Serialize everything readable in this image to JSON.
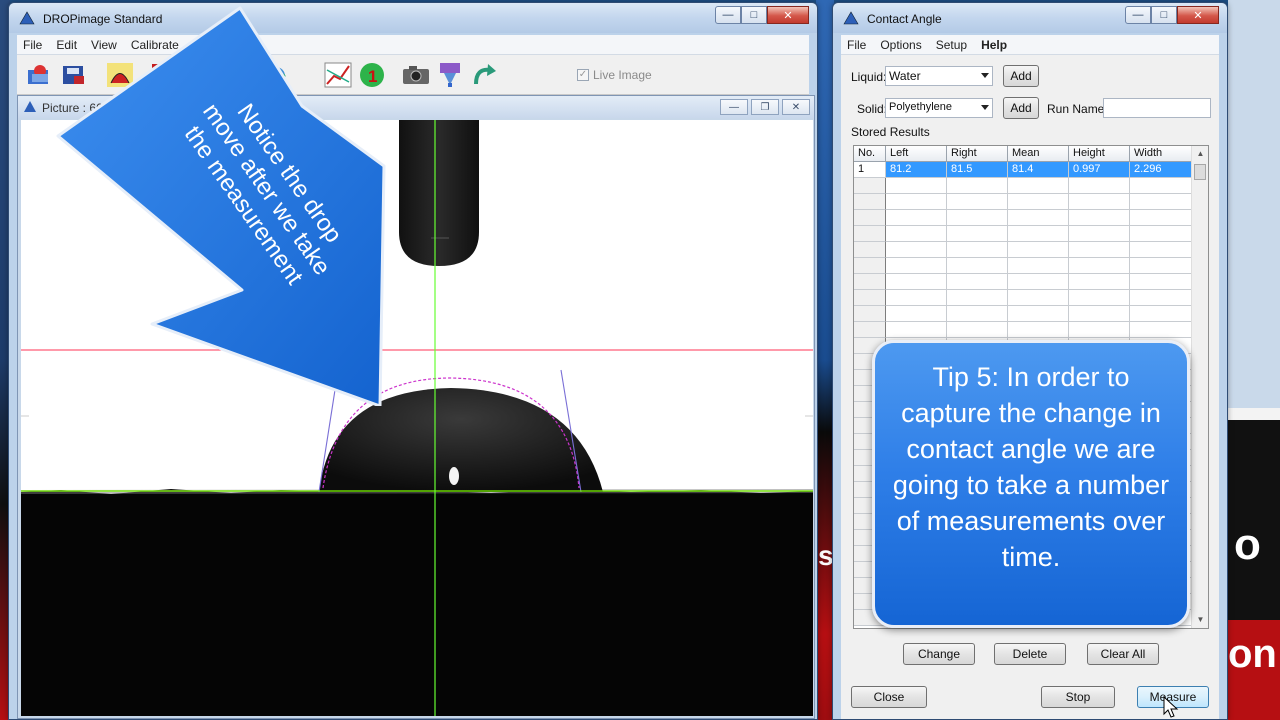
{
  "dropimage_window": {
    "title": "DROPimage Standard",
    "menu": [
      "File",
      "Edit",
      "View",
      "Calibrate",
      "V"
    ],
    "live_image_label": "Live Image",
    "live_image_checked": true,
    "picture_title": "Picture : 66"
  },
  "arrow_callout": {
    "text_lines": [
      "Notice the drop",
      "move after we take",
      "the measurement"
    ]
  },
  "contact_window": {
    "title": "Contact Angle",
    "menu": [
      "File",
      "Options",
      "Setup",
      "Help"
    ],
    "liquid_label": "Liquid:",
    "liquid_value": "Water",
    "solid_label": "Solid:",
    "solid_value": "Polyethylene",
    "add_label": "Add",
    "run_name_label": "Run Name:",
    "run_name_value": "",
    "stored_results_label": "Stored Results",
    "table": {
      "columns": [
        "No.",
        "Left",
        "Right",
        "Mean",
        "Height",
        "Width"
      ],
      "rows": [
        {
          "no": "1",
          "left": "81.2",
          "right": "81.5",
          "mean": "81.4",
          "height": "0.997",
          "width": "2.296"
        }
      ]
    },
    "buttons": {
      "change": "Change",
      "delete": "Delete",
      "clear_all": "Clear All",
      "close": "Close",
      "stop": "Stop",
      "measure": "Measure"
    }
  },
  "tip": {
    "text": "Tip 5: In order to capture the change in contact angle we are going to take a number of measurements over time."
  },
  "background": {
    "fragment_1": "o",
    "fragment_2": "on",
    "fragment_3": "s"
  },
  "colors": {
    "selection": "#3399ff",
    "tip_blue": "#2f7fe8",
    "baseline_green": "#7cfc00",
    "crosshair_green": "#66ff33",
    "reference_red": "#ff3355",
    "fit_magenta": "#cc33cc"
  }
}
